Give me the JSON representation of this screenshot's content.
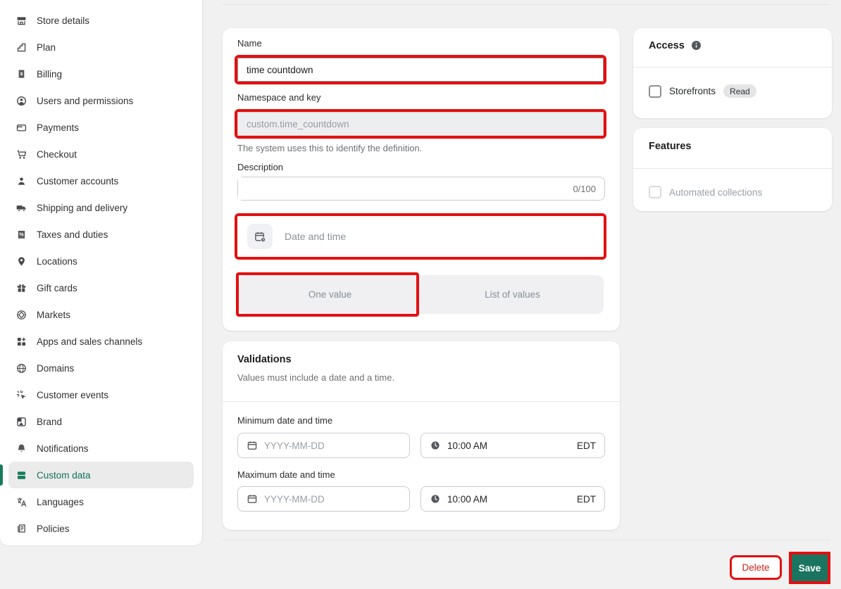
{
  "sidebar": {
    "items": [
      {
        "label": "Store details"
      },
      {
        "label": "Plan"
      },
      {
        "label": "Billing"
      },
      {
        "label": "Users and permissions"
      },
      {
        "label": "Payments"
      },
      {
        "label": "Checkout"
      },
      {
        "label": "Customer accounts"
      },
      {
        "label": "Shipping and delivery"
      },
      {
        "label": "Taxes and duties"
      },
      {
        "label": "Locations"
      },
      {
        "label": "Gift cards"
      },
      {
        "label": "Markets"
      },
      {
        "label": "Apps and sales channels"
      },
      {
        "label": "Domains"
      },
      {
        "label": "Customer events"
      },
      {
        "label": "Brand"
      },
      {
        "label": "Notifications"
      },
      {
        "label": "Custom data",
        "selected": true
      },
      {
        "label": "Languages"
      },
      {
        "label": "Policies"
      }
    ]
  },
  "definition": {
    "name_label": "Name",
    "name_value": "time countdown",
    "namespace_label": "Namespace and key",
    "namespace_value": "custom.time_countdown",
    "namespace_help": "The system uses this to identify the definition.",
    "description_label": "Description",
    "description_counter": "0/100",
    "type_label": "Date and time",
    "one_value_label": "One value",
    "list_of_values_label": "List of values"
  },
  "validations": {
    "title": "Validations",
    "subtitle": "Values must include a date and a time.",
    "min_label": "Minimum date and time",
    "max_label": "Maximum date and time",
    "date_placeholder": "YYYY-MM-DD",
    "time_value": "10:00 AM",
    "timezone": "EDT"
  },
  "access": {
    "title": "Access",
    "option_label": "Storefronts",
    "badge": "Read"
  },
  "features": {
    "title": "Features",
    "option_label": "Automated collections"
  },
  "footer": {
    "delete_label": "Delete",
    "save_label": "Save"
  },
  "colors": {
    "accent_green": "#1a7560",
    "selected_green": "#15705a",
    "annotation_red": "#e31010"
  }
}
